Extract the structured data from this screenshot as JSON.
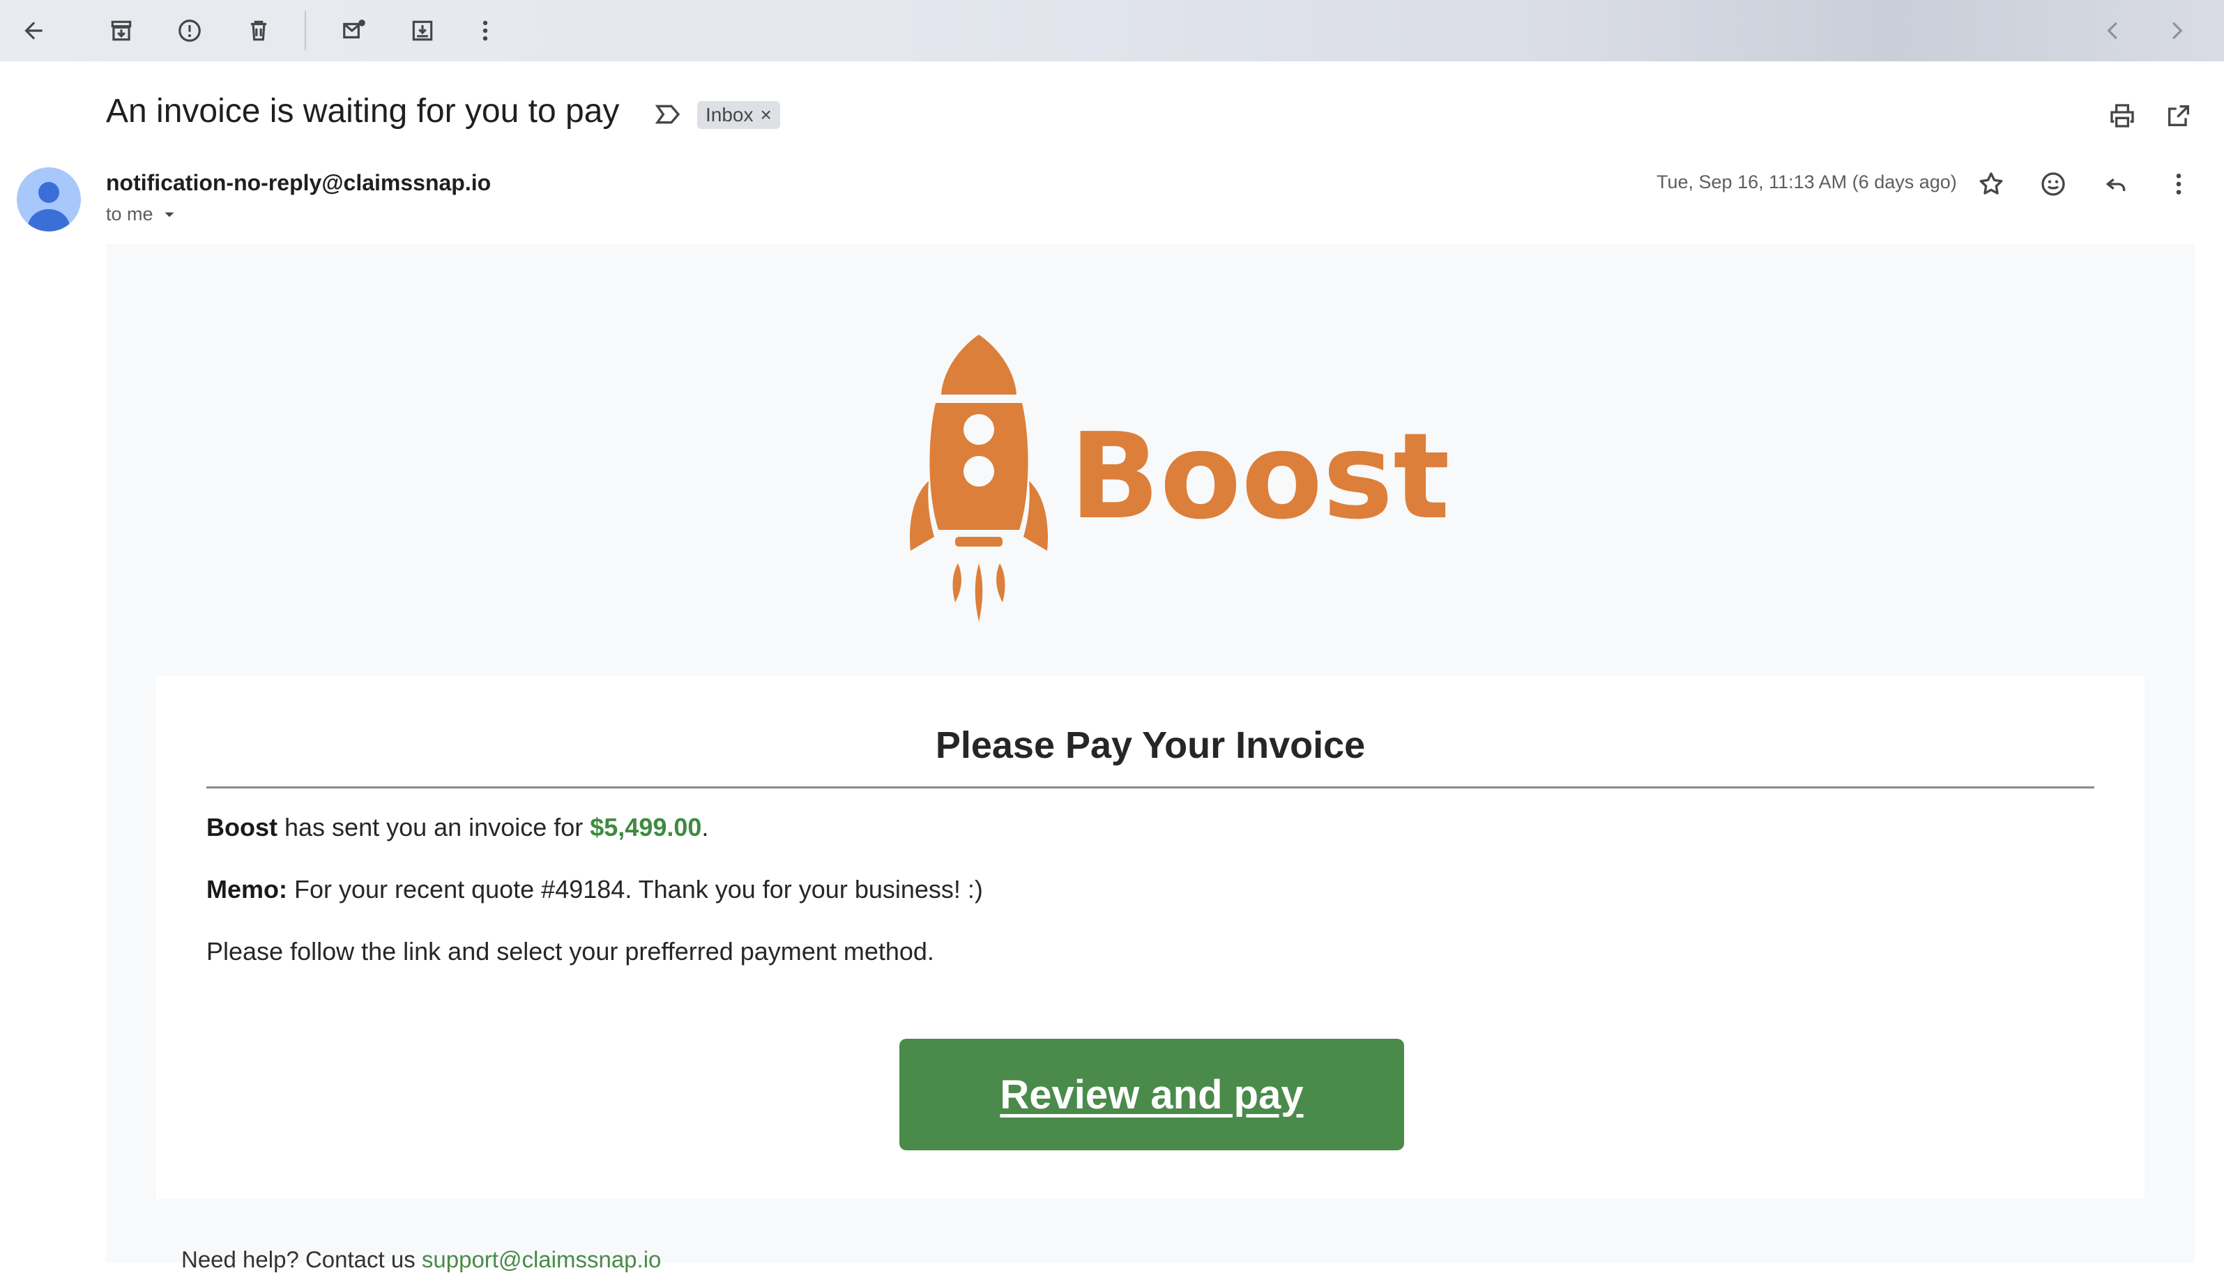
{
  "toolbar": {
    "icons": [
      "back-arrow-icon",
      "archive-icon",
      "report-spam-icon",
      "delete-icon",
      "mark-unread-icon",
      "move-to-icon",
      "more-vert-icon",
      "chevron-left-icon",
      "chevron-right-icon"
    ]
  },
  "email": {
    "subject": "An invoice is waiting for you to pay",
    "label_chip": "Inbox",
    "label_chip_close": "×",
    "sender": "notification-no-reply@claimssnap.io",
    "recipient": "to me",
    "date": "Tue, Sep 16, 11:13 AM (6 days ago)"
  },
  "content": {
    "brand": "Boost",
    "brand_color": "#dc7f3a",
    "title": "Please Pay Your Invoice",
    "line1_bold": "Boost",
    "line1_text": " has sent you an invoice for ",
    "amount": "$5,499.00",
    "line1_end": ".",
    "memo_label": "Memo:",
    "memo_text": " For your recent quote #49184. Thank you for your business! :)",
    "instruction": "Please follow the link and select your prefferred payment method.",
    "button_label": "Review and pay",
    "button_color": "#4a8a4a",
    "help_text": "Need help? Contact us ",
    "help_email": "support@claimssnap.io"
  }
}
